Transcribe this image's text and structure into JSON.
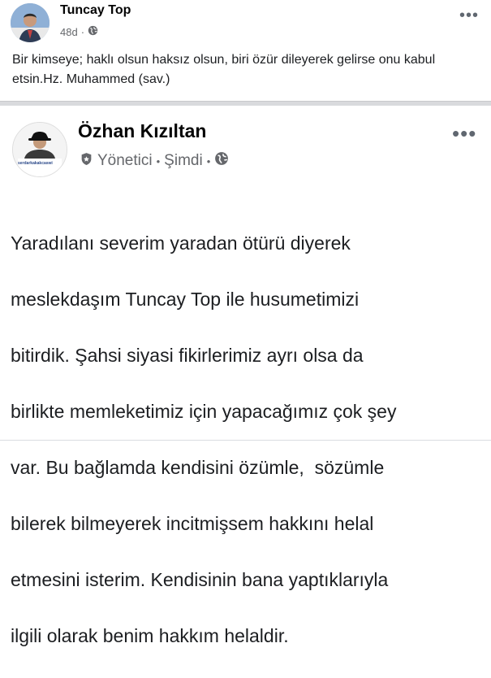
{
  "post1": {
    "author": "Tuncay Top",
    "time": "48d",
    "time_sep": "·",
    "privacy_icon": "globe-icon",
    "more_icon": "more-dots-icon",
    "more_label": "•••",
    "text": "Bir kimseye; haklı olsun haksız olsun, biri özür dileyerek gelirse onu kabul etsin.Hz. Muhammed (sav.)"
  },
  "post2": {
    "author": "Özhan Kızıltan",
    "role_icon": "admin-badge-icon",
    "role": "Yönetici",
    "sep1": "•",
    "time": "Şimdi",
    "sep2": "•",
    "privacy_icon": "globe-icon",
    "more_icon": "more-dots-icon",
    "more_label": "•••",
    "avatar_caption": "serdarkakakcaswi",
    "text_lines": [
      "Yaradılanı severim yaradan ötürü diyerek",
      "meslekdaşım Tuncay Top ile husumetimizi",
      "bitirdik. Şahsi siyasi fikirlerimiz ayrı olsa da",
      "birlikte memleketimiz için yapacağımız çok şey",
      "var. Bu bağlamda kendisini özümle,  sözümle",
      "bilerek bilmeyerek incitmişsem hakkını helal",
      "etmesini isterim. Kendisinin bana yaptıklarıyla",
      "ilgili olarak benim hakkım helaldir."
    ]
  },
  "colors": {
    "text": "#050505",
    "secondary": "#65676b",
    "separator": "#d9dadd"
  }
}
